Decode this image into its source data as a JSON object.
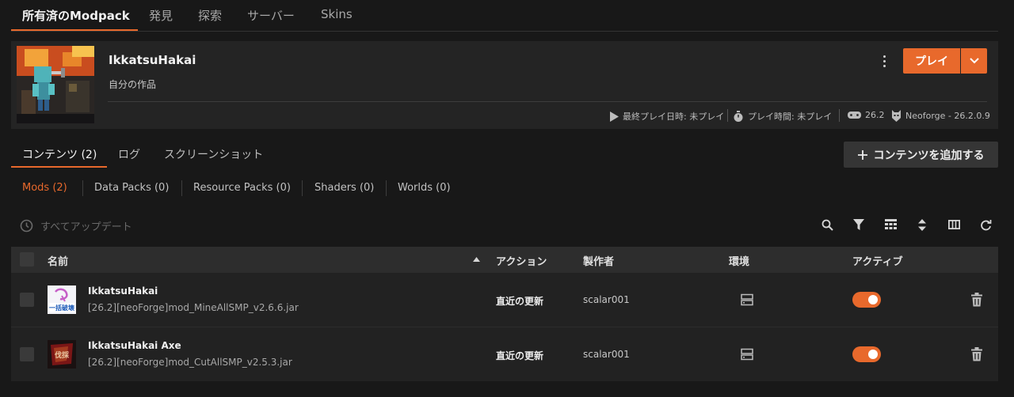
{
  "top_tabs": [
    "所有済のModpack",
    "発見",
    "探索",
    "サーバー",
    "Skins"
  ],
  "modpack": {
    "title": "IkkatsuHakai",
    "subtitle": "自分の作品",
    "play_label": "プレイ",
    "last_played": "最終プレイ日時: 未プレイ",
    "play_time": "プレイ時間: 未プレイ",
    "mc_version": "26.2",
    "loader": "Neoforge - 26.2.0.9"
  },
  "content_tabs": [
    "コンテンツ (2)",
    "ログ",
    "スクリーンショット"
  ],
  "add_content_label": "コンテンツを追加する",
  "filters": [
    "Mods (2)",
    "Data Packs (0)",
    "Resource Packs (0)",
    "Shaders (0)",
    "Worlds (0)"
  ],
  "update_all_label": "すべてアップデート",
  "table": {
    "headers": {
      "name": "名前",
      "action": "アクション",
      "author": "製作者",
      "env": "環境",
      "active": "アクティブ"
    },
    "rows": [
      {
        "name": "IkkatsuHakai",
        "file": "[26.2][neoForge]mod_MineAllSMP_v2.6.6.jar",
        "action": "直近の更新",
        "author": "scalar001",
        "icon_text": "一括破壊",
        "active": true
      },
      {
        "name": "IkkatsuHakai Axe",
        "file": "[26.2][neoForge]mod_CutAllSMP_v2.5.3.jar",
        "action": "直近の更新",
        "author": "scalar001",
        "icon_text": "伐採",
        "active": true
      }
    ]
  },
  "colors": {
    "accent": "#e8692c",
    "background": "#181818",
    "card": "#242424"
  }
}
